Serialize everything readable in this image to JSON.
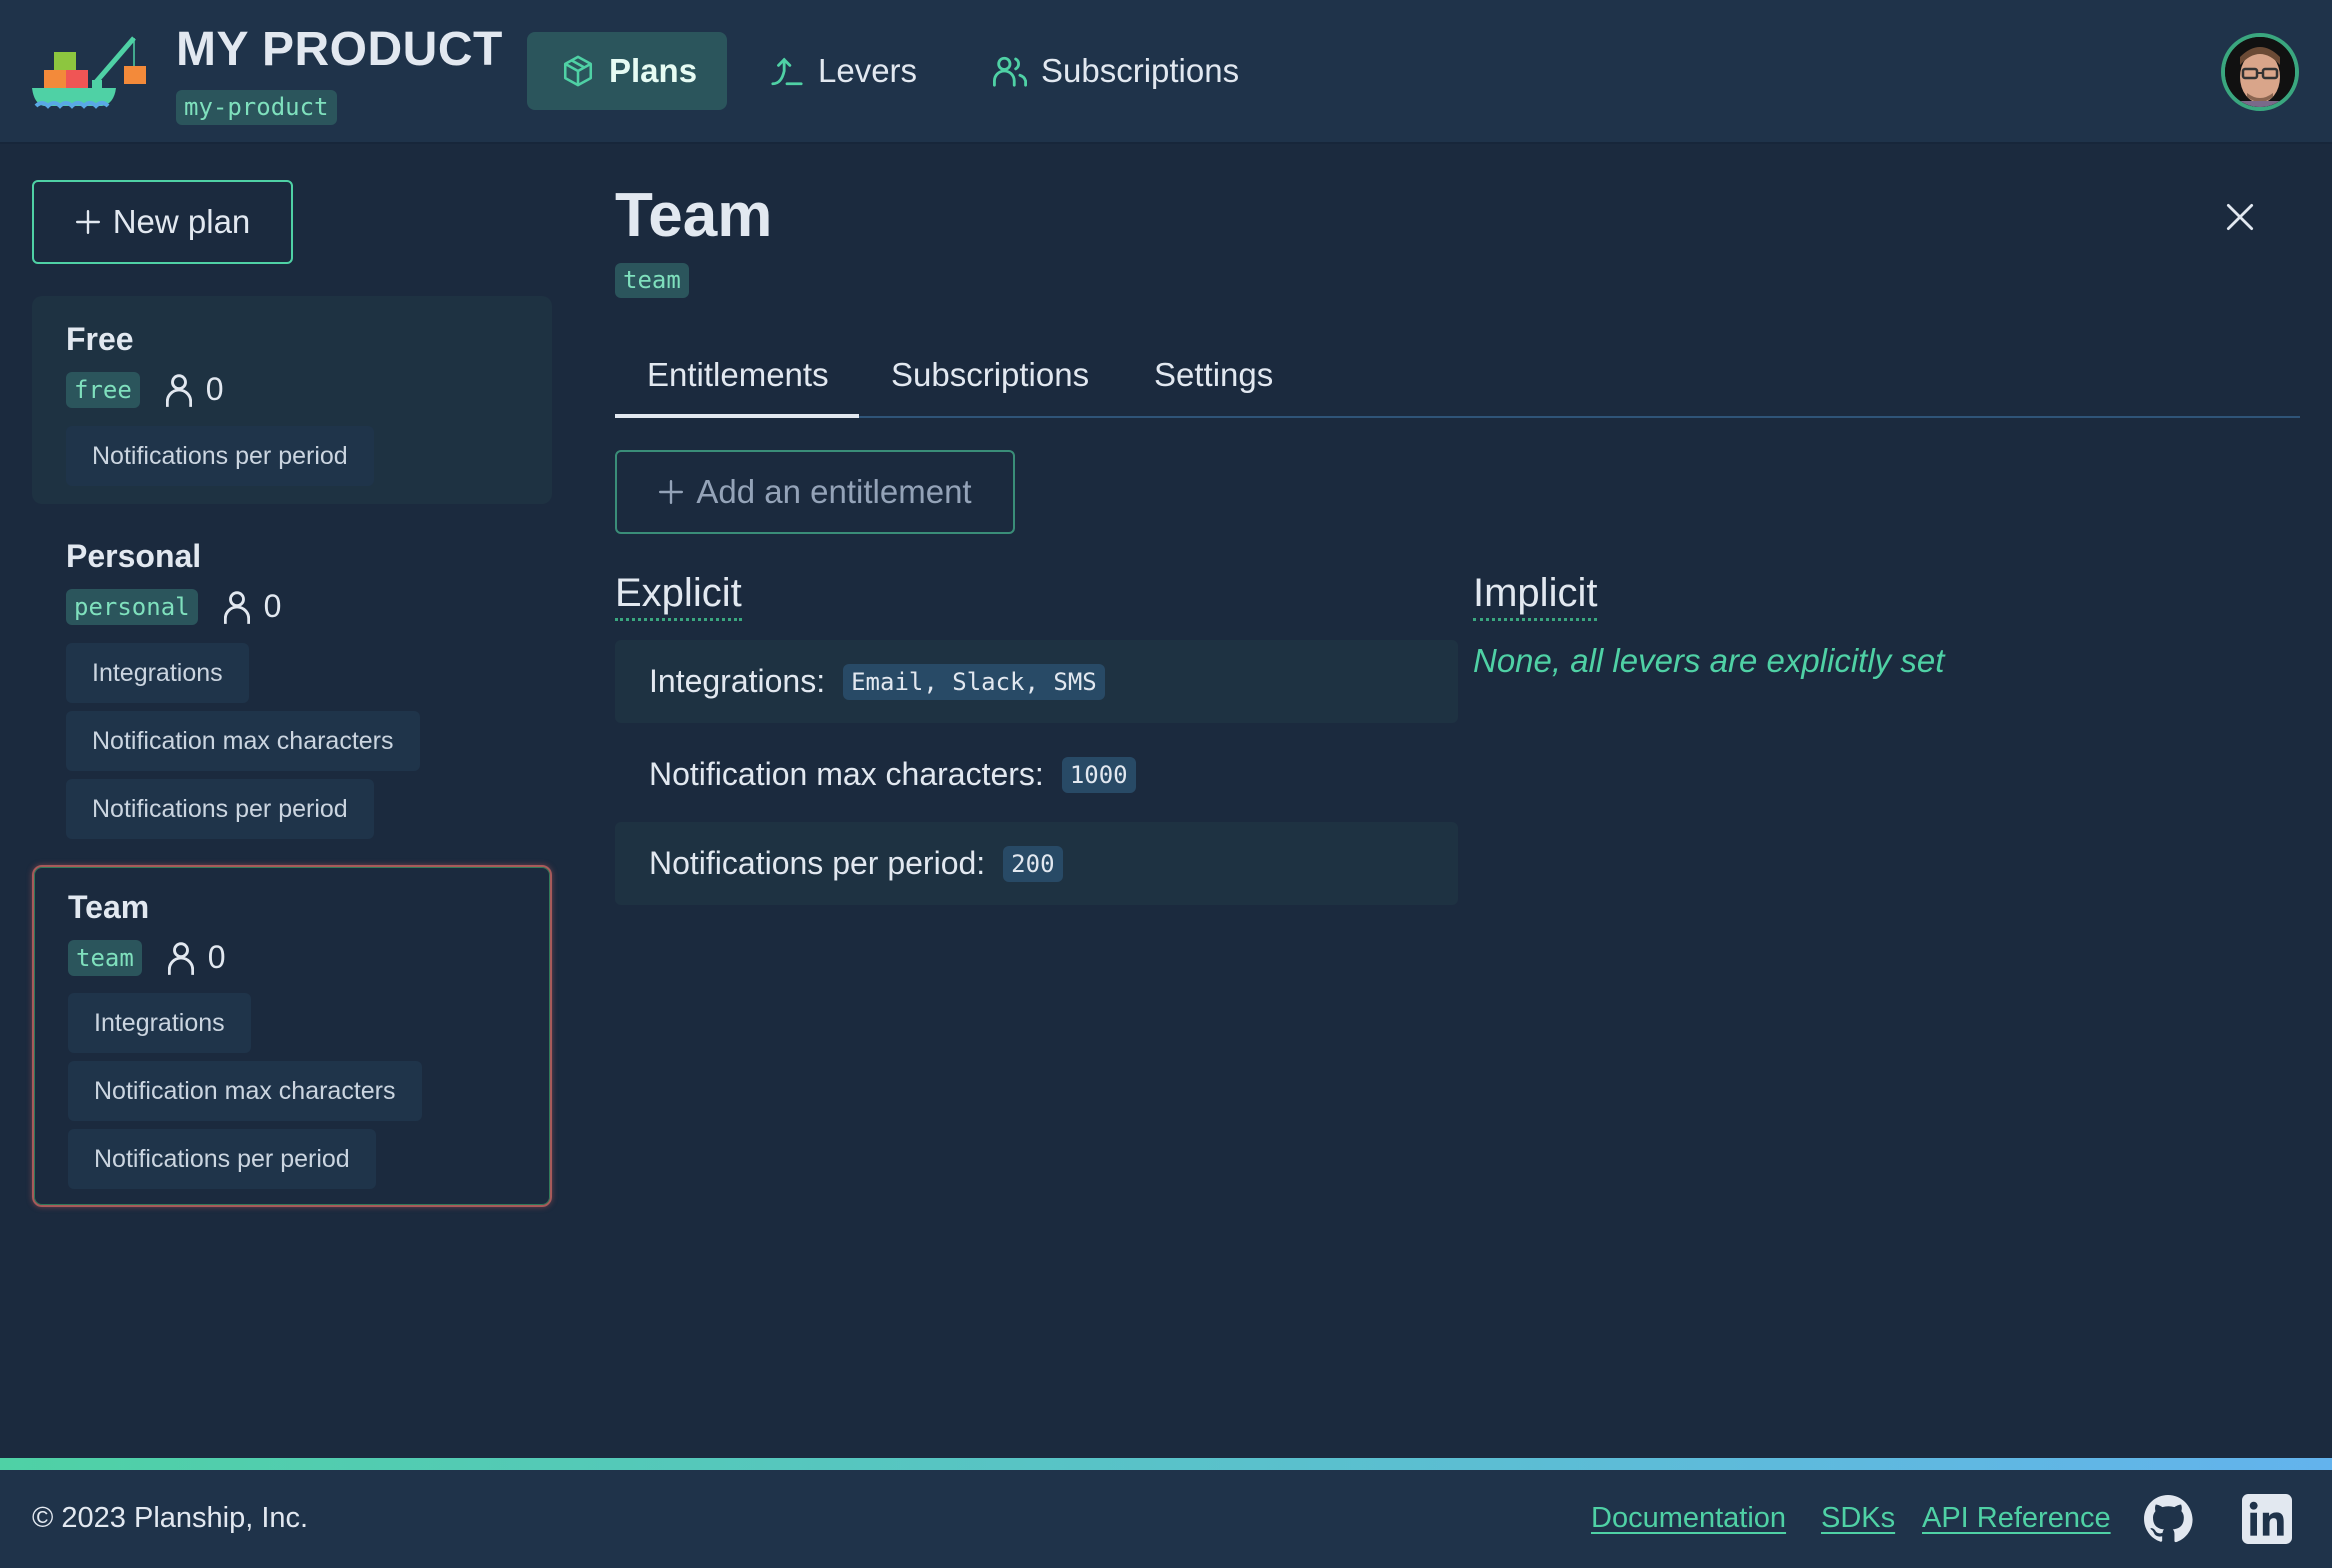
{
  "header": {
    "product_title": "MY PRODUCT",
    "product_slug": "my-product",
    "logo_icon": "cargo-ship-logo",
    "nav": [
      {
        "label": "Plans",
        "icon": "cube-icon",
        "active": true
      },
      {
        "label": "Levers",
        "icon": "lever-arrow-icon",
        "active": false
      },
      {
        "label": "Subscriptions",
        "icon": "users-icon",
        "active": false
      }
    ],
    "avatar_icon": "user-avatar"
  },
  "sidebar": {
    "new_plan_label": "New plan",
    "plans": [
      {
        "name": "Free",
        "slug": "free",
        "subscribers": "0",
        "levers": [
          "Notifications per period"
        ],
        "selected": false
      },
      {
        "name": "Personal",
        "slug": "personal",
        "subscribers": "0",
        "levers": [
          "Integrations",
          "Notification max characters",
          "Notifications per period"
        ],
        "selected": false
      },
      {
        "name": "Team",
        "slug": "team",
        "subscribers": "0",
        "levers": [
          "Integrations",
          "Notification max characters",
          "Notifications per period"
        ],
        "selected": true
      }
    ]
  },
  "detail": {
    "title": "Team",
    "slug": "team",
    "tabs": [
      {
        "label": "Entitlements",
        "active": true
      },
      {
        "label": "Subscriptions",
        "active": false
      },
      {
        "label": "Settings",
        "active": false
      }
    ],
    "add_entitlement_label": "Add an entitlement",
    "explicit_heading": "Explicit",
    "implicit_heading": "Implicit",
    "implicit_text": "None, all levers are explicitly set",
    "entitlements": [
      {
        "label": "Integrations:",
        "value": "Email, Slack, SMS"
      },
      {
        "label": "Notification max characters:",
        "value": "1000"
      },
      {
        "label": "Notifications per period:",
        "value": "200"
      }
    ]
  },
  "footer": {
    "copyright": "© 2023 Planship, Inc.",
    "links": [
      "Documentation",
      "SDKs",
      "API Reference"
    ],
    "icons": [
      "github-icon",
      "linkedin-icon"
    ]
  },
  "colors": {
    "accent": "#4fd1a5",
    "accent_blue": "#63b3ed",
    "header_bg": "#1f334a",
    "page_bg": "#1b2a3e",
    "slug_bg": "#2b555c"
  }
}
